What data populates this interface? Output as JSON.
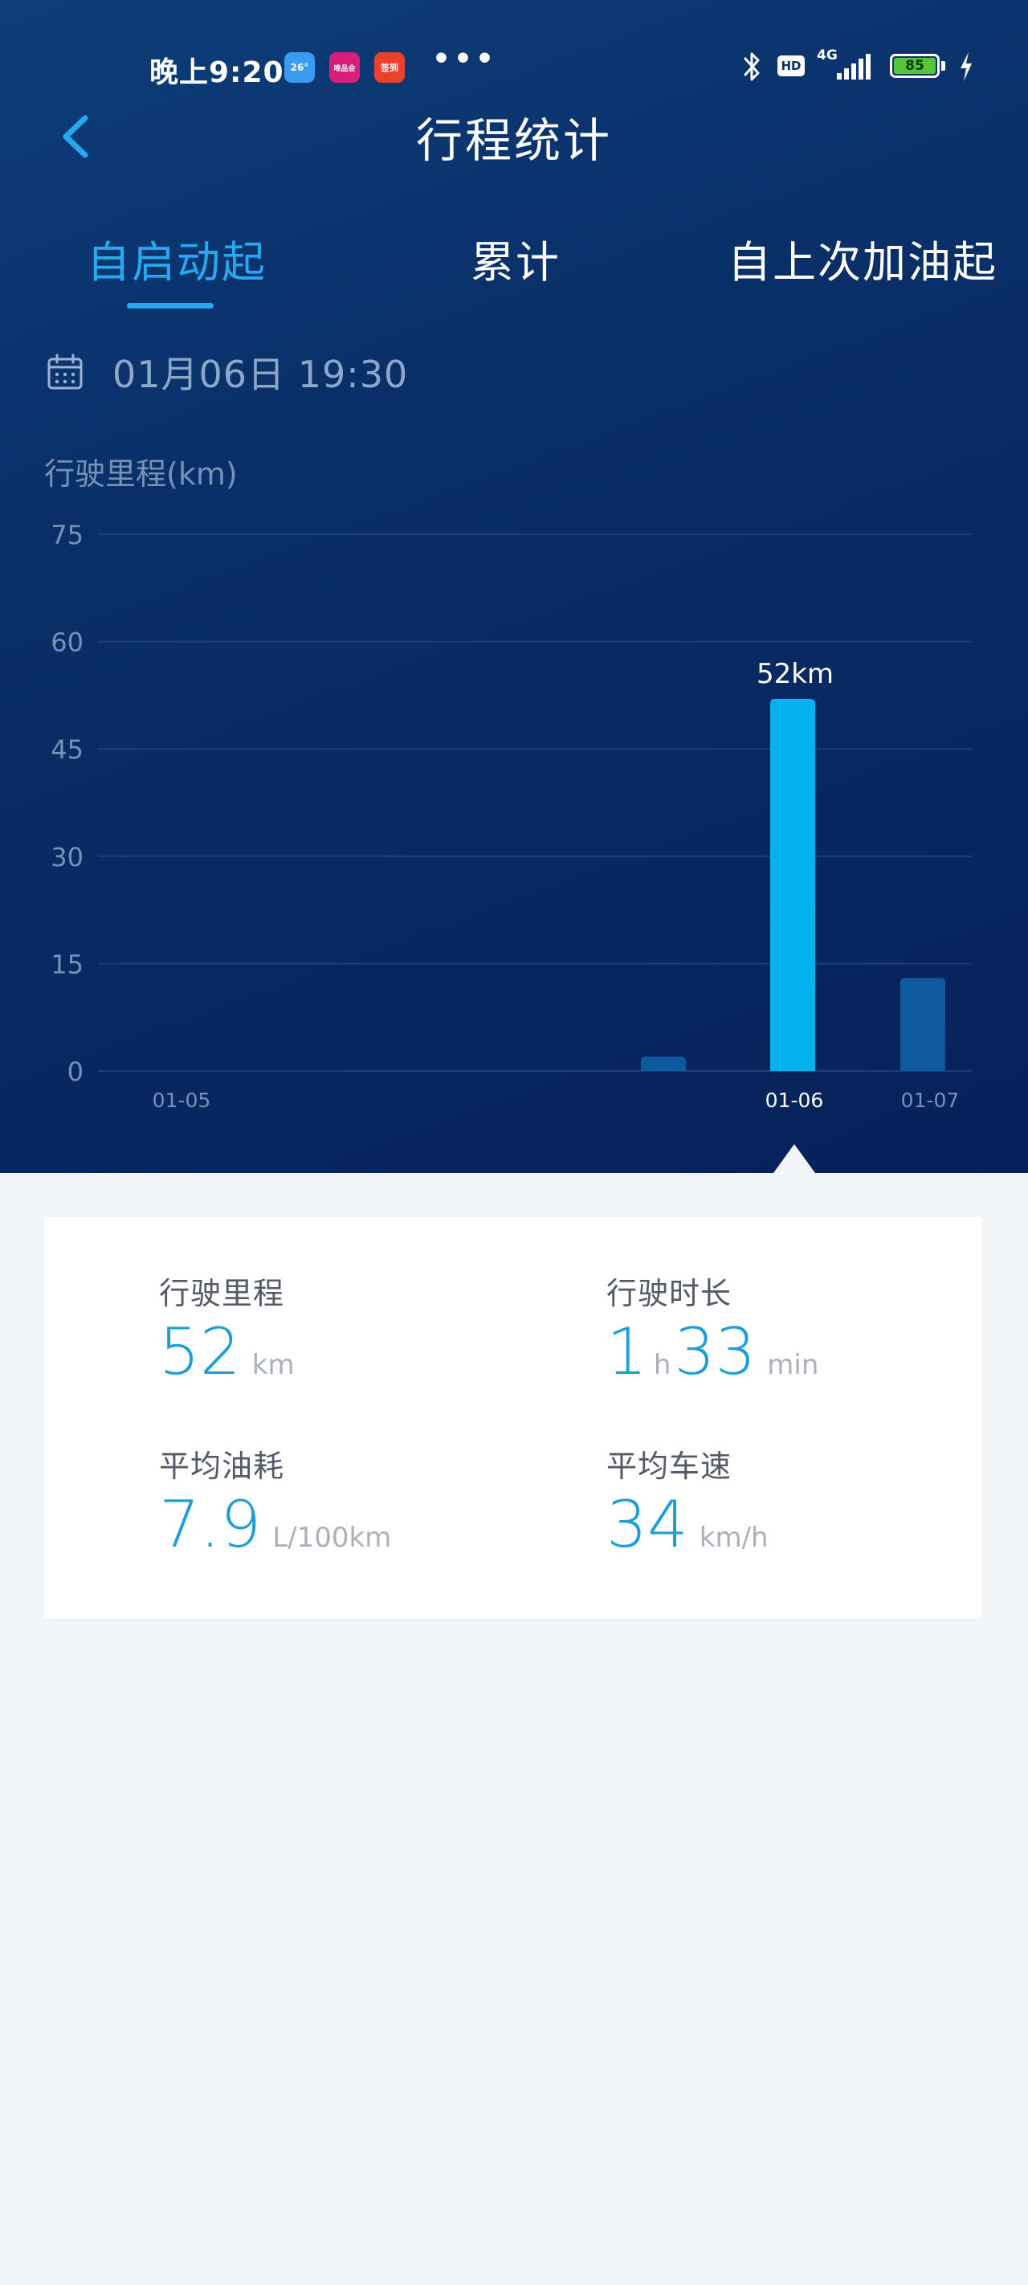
{
  "status_bar": {
    "time": "晚上9:20",
    "app_icons": [
      {
        "name": "weather-icon",
        "label": "26°",
        "color": "#3a9bf0"
      },
      {
        "name": "vip-shop-icon",
        "label": "唯品会",
        "color": "#d81e79"
      },
      {
        "name": "promo-app-icon",
        "label": "签到",
        "color": "#e8412c"
      }
    ],
    "more": "•••",
    "network": "4G",
    "hd": "HD",
    "battery": "85"
  },
  "header": {
    "title": "行程统计"
  },
  "tabs": [
    {
      "label": "自启动起",
      "active": true
    },
    {
      "label": "累计",
      "active": false
    },
    {
      "label": "自上次加油起",
      "active": false
    }
  ],
  "date": "01月06日 19:30",
  "chart_data": {
    "type": "bar",
    "ylabel": "行驶里程(km)",
    "ylim": [
      0,
      75
    ],
    "yticks": [
      0,
      15,
      30,
      45,
      60,
      75
    ],
    "grid": true,
    "x_tick_labels": [
      "01-05",
      "01-06",
      "01-07"
    ],
    "selected_label": "01-06",
    "bars": [
      {
        "value": 2,
        "selected": false
      },
      {
        "value": 52,
        "selected": true,
        "label": "52km"
      },
      {
        "value": 13,
        "selected": false
      }
    ],
    "colors": {
      "selected": "#06b1f0",
      "normal": "#0f5a9e",
      "grid": "#1e3f72",
      "tick": "#7891b6"
    }
  },
  "stats": {
    "mileage": {
      "label": "行驶里程",
      "value": "52",
      "unit": "km"
    },
    "duration": {
      "label": "行驶时长",
      "hours": "1",
      "hours_unit": "h",
      "minutes": "33",
      "minutes_unit": "min"
    },
    "fuel": {
      "label": "平均油耗",
      "value": "7.9",
      "unit": "L/100km"
    },
    "speed": {
      "label": "平均车速",
      "value": "34",
      "unit": "km/h"
    }
  }
}
